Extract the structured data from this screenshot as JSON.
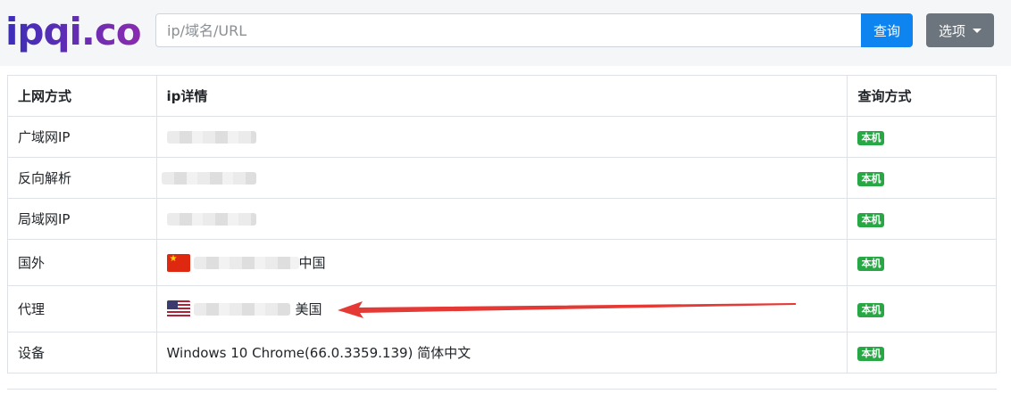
{
  "header": {
    "logo": "ipqi.co",
    "search_placeholder": "ip/域名/URL",
    "query_label": "查询",
    "options_label": "选项"
  },
  "table": {
    "headers": [
      "上网方式",
      "ip详情",
      "查询方式"
    ],
    "rows": [
      {
        "label": "广域网IP",
        "detail": "",
        "method": "本机"
      },
      {
        "label": "反向解析",
        "detail": "",
        "method": "本机"
      },
      {
        "label": "局域网IP",
        "detail": "",
        "method": "本机"
      },
      {
        "label": "国外",
        "detail": "中国",
        "method": "本机"
      },
      {
        "label": "代理",
        "detail": "美国",
        "method": "本机"
      },
      {
        "label": "设备",
        "detail": "Windows 10 Chrome(66.0.3359.139) 简体中文",
        "method": "本机"
      }
    ]
  },
  "colors": {
    "primary": "#0d84f0",
    "secondary": "#6c757d",
    "badge": "#28a745",
    "logo": "#5a2aa8",
    "arrow": "#e53935"
  },
  "icons": {
    "row4_flag": "china-flag-icon",
    "row5_flag": "usa-flag-icon",
    "dropdown": "caret-down-icon",
    "annotation": "red-arrow-icon"
  }
}
